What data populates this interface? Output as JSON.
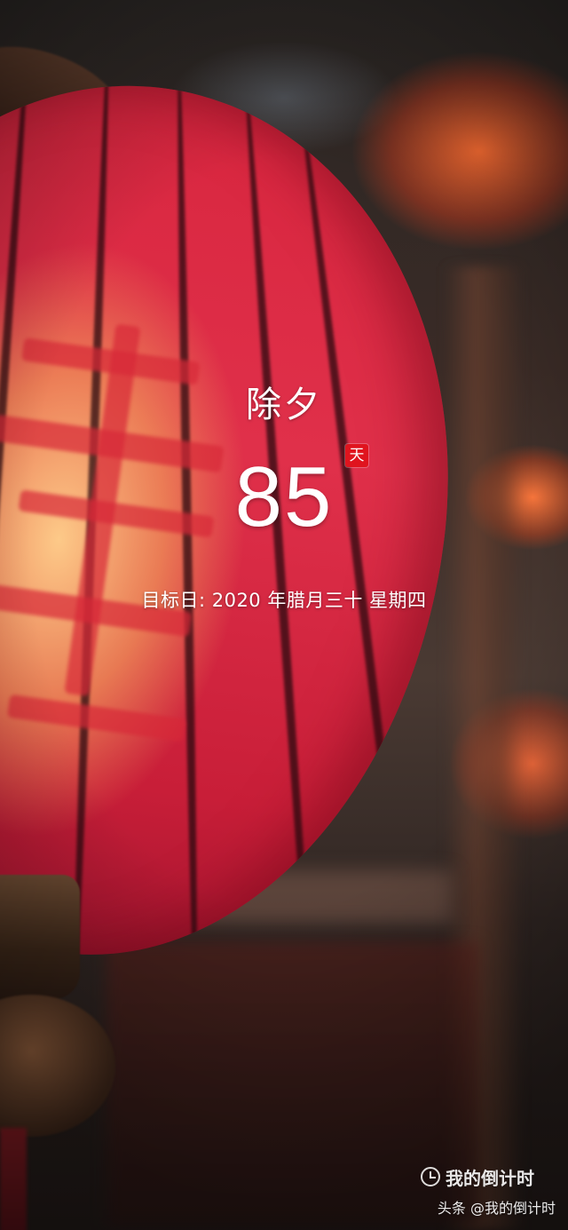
{
  "countdown": {
    "event_name": "除夕",
    "days_remaining": "85",
    "day_unit": "天",
    "target_date_text": "目标日: 2020 年腊月三十  星期四"
  },
  "watermark": {
    "icon": "clock-icon",
    "brand": "我的倒计时",
    "source": "头条 @我的倒计时"
  },
  "colors": {
    "badge_red": "#e0141e",
    "text": "#ffffff",
    "lantern_red": "#d8263f"
  }
}
